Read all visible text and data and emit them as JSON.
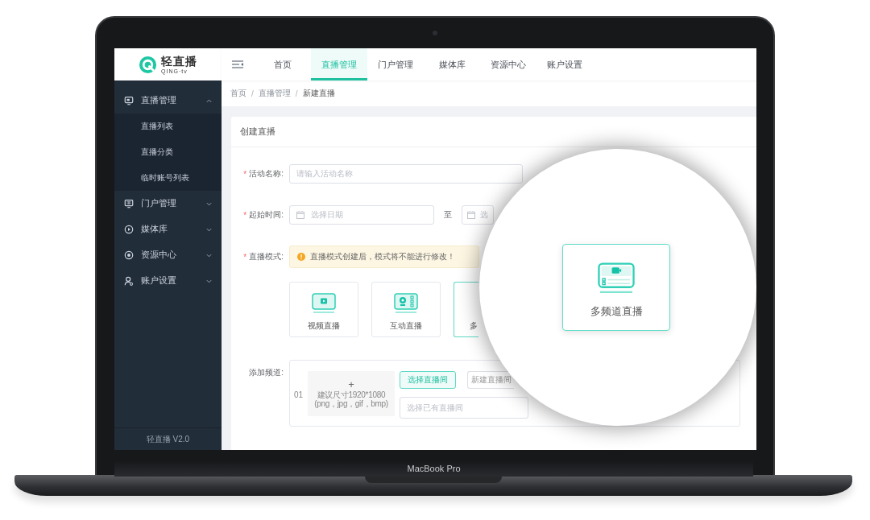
{
  "laptop": {
    "label": "MacBook Pro"
  },
  "sidebar": {
    "brand": "轻直播",
    "brand_sub": "QING·tv",
    "items": [
      {
        "label": "直播管理",
        "kind": "monitor",
        "expanded": true,
        "children": [
          {
            "label": "直播列表"
          },
          {
            "label": "直播分类"
          },
          {
            "label": "临时账号列表"
          }
        ]
      },
      {
        "label": "门户管理",
        "kind": "portal",
        "expanded": false
      },
      {
        "label": "媒体库",
        "kind": "play",
        "expanded": false
      },
      {
        "label": "资源中心",
        "kind": "resource",
        "expanded": false
      },
      {
        "label": "账户设置",
        "kind": "account",
        "expanded": false
      }
    ],
    "footer": "轻直播 V2.0"
  },
  "top_nav": {
    "tabs": [
      {
        "label": "首页",
        "selected": false
      },
      {
        "label": "直播管理",
        "selected": true
      },
      {
        "label": "门户管理",
        "selected": false
      },
      {
        "label": "媒体库",
        "selected": false
      },
      {
        "label": "资源中心",
        "selected": false
      },
      {
        "label": "账户设置",
        "selected": false
      }
    ]
  },
  "breadcrumb": {
    "separator": "/",
    "items": [
      "首页",
      "直播管理",
      "新建直播"
    ]
  },
  "panel": {
    "title": "创建直播",
    "fields": [
      {
        "kind": "text",
        "mark": "*",
        "label": "活动名称:",
        "placeholder": "请输入活动名称"
      },
      {
        "kind": "date_range",
        "mark": "*",
        "label": "起始时间:",
        "start_placeholder": "选择日期",
        "separator": "至",
        "end_placeholder": "选"
      },
      {
        "kind": "mode",
        "mark": "*",
        "label": "直播模式:",
        "notice": "直播模式创建后，模式将不能进行修改！",
        "options": [
          {
            "label": "视频直播",
            "kind": "video",
            "selected": false
          },
          {
            "label": "互动直播",
            "kind": "interactive",
            "selected": false
          },
          {
            "label": "多",
            "selected": true
          }
        ]
      },
      {
        "kind": "channel",
        "label": "添加频道:",
        "number": "01",
        "upload_symbol": "+",
        "upload_hint": "建议尺寸1920*1080",
        "upload_formats": "(png，jpg，gif，bmp)",
        "buttons": [
          {
            "label": "选择直播间",
            "selected": true
          },
          {
            "label": "新建直播间",
            "selected": false
          }
        ],
        "select_placeholder": "选择已有直播间"
      }
    ]
  },
  "magnifier": {
    "label": "多频道直播",
    "kind": "multi",
    "selected": true
  }
}
